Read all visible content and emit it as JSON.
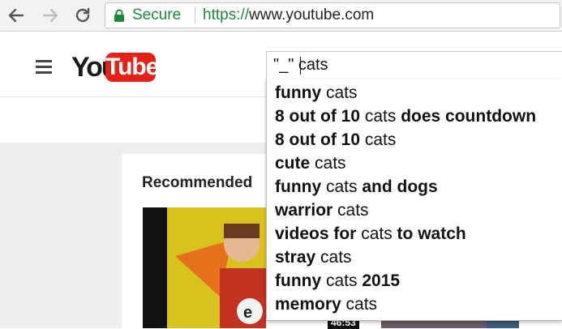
{
  "browser": {
    "security_label": "Secure",
    "url_scheme": "https://",
    "url_host": "www.youtube.com"
  },
  "header": {
    "logo_you": "You",
    "logo_tube": "Tube",
    "search_value": "\"_\" cats"
  },
  "suggestions": [
    {
      "parts": [
        {
          "t": "funny",
          "b": true
        },
        {
          "t": " cats",
          "b": false
        }
      ]
    },
    {
      "parts": [
        {
          "t": "8 out of 10",
          "b": true
        },
        {
          "t": " cats ",
          "b": false
        },
        {
          "t": "does countdown",
          "b": true
        }
      ]
    },
    {
      "parts": [
        {
          "t": "8 out of 10",
          "b": true
        },
        {
          "t": " cats",
          "b": false
        }
      ]
    },
    {
      "parts": [
        {
          "t": "cute",
          "b": true
        },
        {
          "t": " cats",
          "b": false
        }
      ]
    },
    {
      "parts": [
        {
          "t": "funny",
          "b": true
        },
        {
          "t": " cats ",
          "b": false
        },
        {
          "t": "and dogs",
          "b": true
        }
      ]
    },
    {
      "parts": [
        {
          "t": "warrior",
          "b": true
        },
        {
          "t": " cats",
          "b": false
        }
      ]
    },
    {
      "parts": [
        {
          "t": "videos for",
          "b": true
        },
        {
          "t": " cats ",
          "b": false
        },
        {
          "t": "to watch",
          "b": true
        }
      ]
    },
    {
      "parts": [
        {
          "t": "stray",
          "b": true
        },
        {
          "t": " cats",
          "b": false
        }
      ]
    },
    {
      "parts": [
        {
          "t": "funny",
          "b": true
        },
        {
          "t": " cats ",
          "b": false
        },
        {
          "t": "2015",
          "b": true
        }
      ]
    },
    {
      "parts": [
        {
          "t": "memory",
          "b": true
        },
        {
          "t": " cats",
          "b": false
        }
      ]
    }
  ],
  "content": {
    "section_title": "Recommended",
    "video_duration": "46:53"
  },
  "colors": {
    "secure_green": "#1d8a3a",
    "youtube_red": "#e62117"
  }
}
